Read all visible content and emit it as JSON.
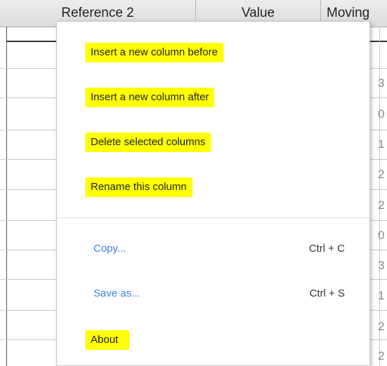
{
  "header": {
    "columns": [
      "Reference 2",
      "Value",
      "Moving"
    ]
  },
  "grid": {
    "edge_digits": [
      "3",
      "0",
      "1",
      "2",
      "2",
      "0",
      "3",
      "1",
      "2",
      "2"
    ]
  },
  "context_menu": {
    "items": [
      {
        "label": "Insert a new column before",
        "highlighted": true
      },
      {
        "label": "Insert a new column after",
        "highlighted": true
      },
      {
        "label": "Delete selected columns",
        "highlighted": true
      },
      {
        "label": "Rename this column",
        "highlighted": true
      },
      {
        "label": "Copy...",
        "shortcut": "Ctrl + C"
      },
      {
        "label": "Save as...",
        "shortcut": "Ctrl + S"
      },
      {
        "label": "About",
        "highlighted": true
      }
    ]
  },
  "colors": {
    "highlight": "#ffff00",
    "link": "#3c7fe0"
  }
}
